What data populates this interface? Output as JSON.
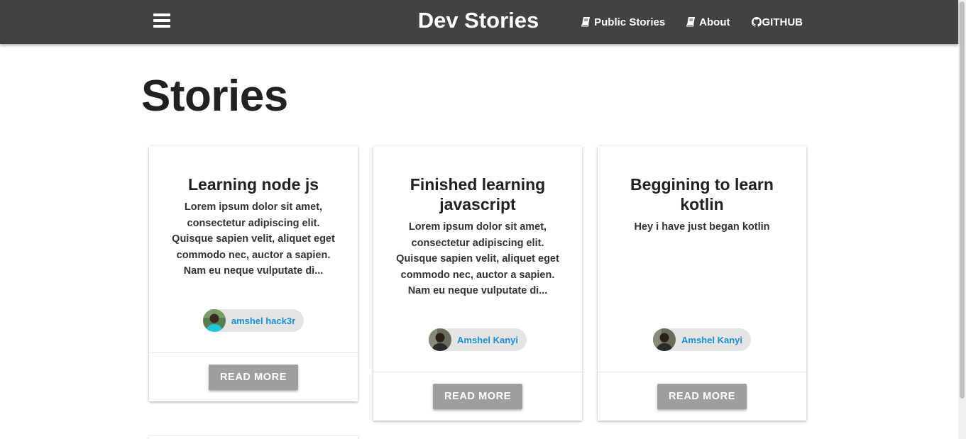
{
  "navbar": {
    "brand": "Dev Stories",
    "links": [
      {
        "label": "Public Stories",
        "icon": "book-icon"
      },
      {
        "label": "About",
        "icon": "book-icon"
      },
      {
        "label": "GITHUB",
        "icon": "github-icon"
      }
    ]
  },
  "page": {
    "title": "Stories"
  },
  "stories": [
    {
      "title": "Learning node js",
      "body": "Lorem ipsum dolor sit amet, consectetur adipiscing elit. Quisque sapien velit, aliquet eget commodo nec, auctor a sapien. Nam eu neque vulputate di...",
      "author": "amshel hack3r",
      "button": "READ MORE"
    },
    {
      "title": "Finished learning javascript",
      "body": "Lorem ipsum dolor sit amet, consectetur adipiscing elit. Quisque sapien velit, aliquet eget commodo nec, auctor a sapien. Nam eu neque vulputate di...",
      "author": "Amshel Kanyi",
      "button": "READ MORE"
    },
    {
      "title": "Beggining to learn kotlin",
      "body": "Hey i have just began kotlin",
      "author": "Amshel Kanyi",
      "button": "READ MORE"
    }
  ],
  "colors": {
    "navbar": "#424242",
    "button": "#9e9e9e",
    "author_link": "#1a8fd0"
  }
}
